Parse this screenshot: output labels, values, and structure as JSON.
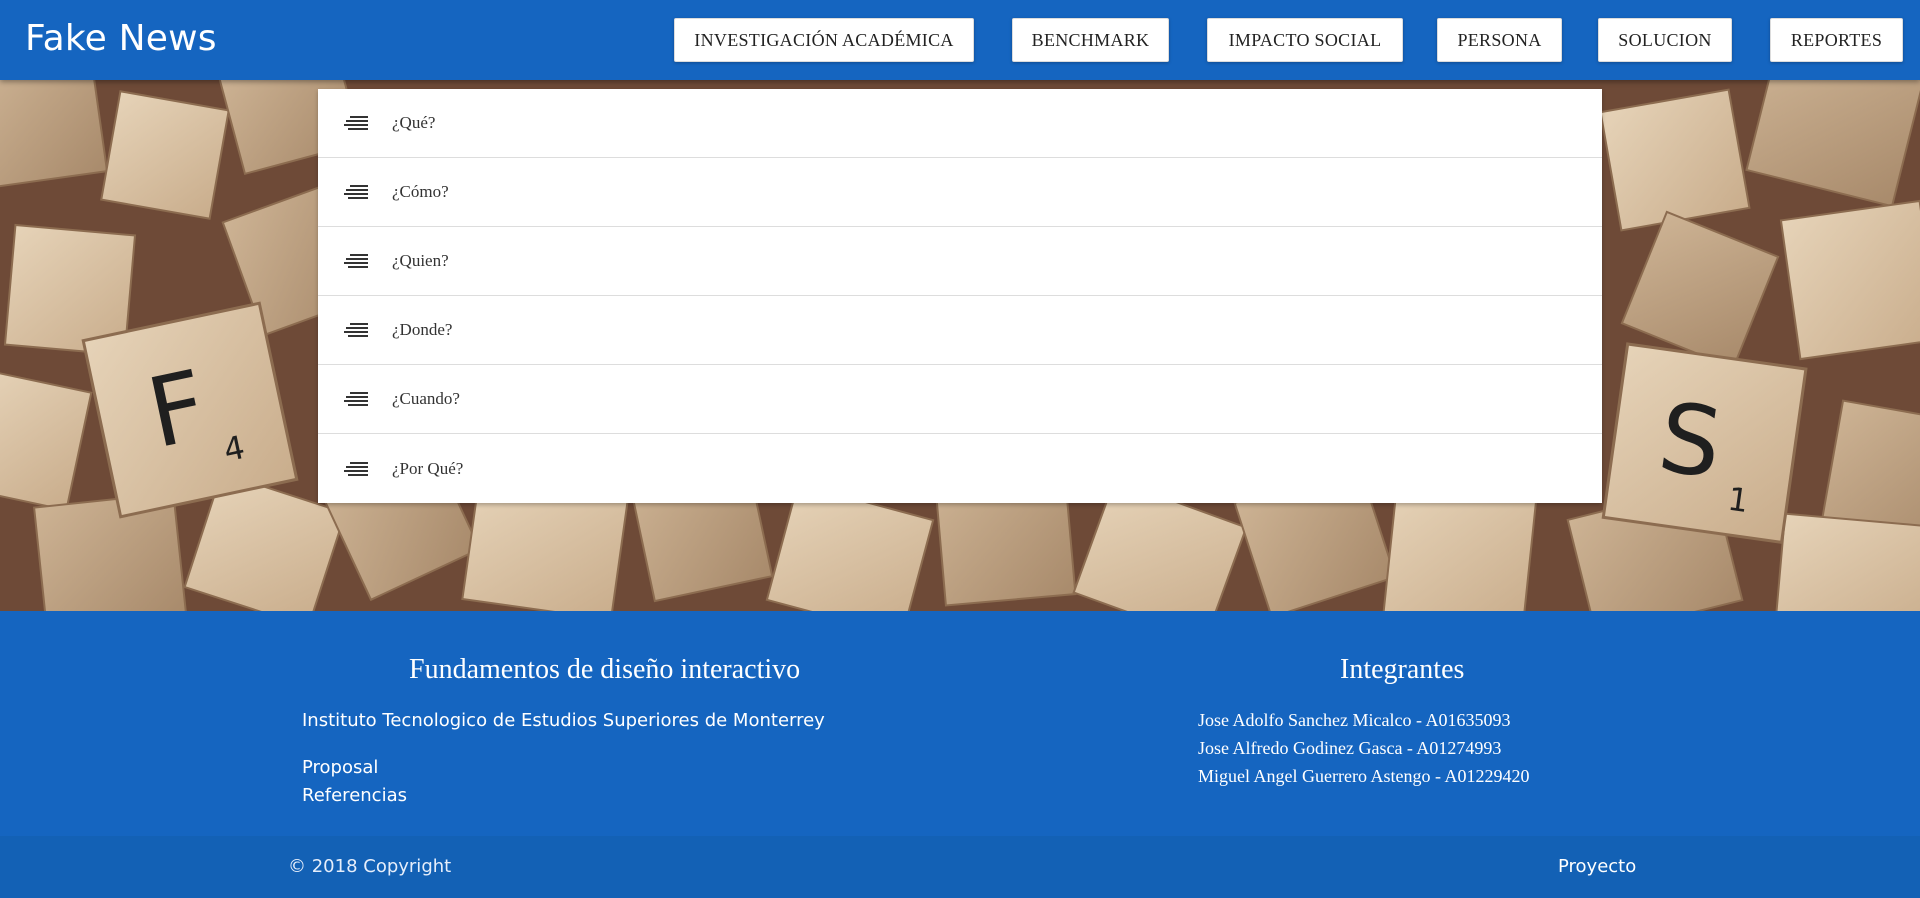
{
  "navbar": {
    "brand": "Fake News",
    "links": [
      "INVESTIGACIÓN ACADÉMICA",
      "BENCHMARK",
      "IMPACTO SOCIAL",
      "PERSONA",
      "SOLUCION",
      "REPORTES"
    ]
  },
  "hero": {
    "tile_letters": {
      "f": "F",
      "f_score": "4",
      "s": "S",
      "s_score": "1"
    }
  },
  "collapsible": {
    "items": [
      "¿Qué?",
      "¿Cómo?",
      "¿Quien?",
      "¿Donde?",
      "¿Cuando?",
      "¿Por Qué?"
    ],
    "icon": "short-text-icon"
  },
  "footer": {
    "left_title": "Fundamentos de diseño interactivo",
    "institution": "Instituto Tecnologico de Estudios Superiores de Monterrey",
    "links": [
      "Proposal",
      "Referencias"
    ],
    "right_title": "Integrantes",
    "members": [
      "Jose Adolfo Sanchez Micalco - A01635093",
      "Jose Alfredo Godinez Gasca - A01274993",
      "Miguel Angel Guerrero Astengo - A01229420"
    ],
    "copyright": "© 2018 Copyright",
    "copyright_link": "Proyecto"
  },
  "colors": {
    "primary": "#1565c0",
    "copyright_bar": "#1361b5",
    "tile": "#d9c3a6",
    "table": "#6e4a37"
  }
}
